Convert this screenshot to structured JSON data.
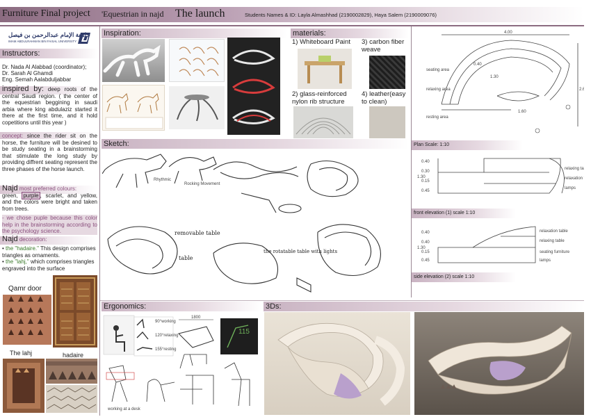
{
  "header": {
    "title": "Furniture Final project",
    "subtitle_prefix": "'Equestrian in najd",
    "subtitle_main": "The launch",
    "students": "Students Names & ID: Layla Almashhad (2190002829), Haya Salem (2190009076)"
  },
  "university": {
    "arabic": "جامعة الإمام عبدالرحمن بن فيصل",
    "english": "IMAM ABDULRAHMAN BIN FAISAL UNIVERSITY"
  },
  "left": {
    "instructors_title": "Instructors:",
    "instructors": [
      "Dr. Nada Al Alabbad (coordinator);",
      "Dr. Sarah Al Ghamdi",
      "Eng. Semah Aalabduljabbar"
    ],
    "inspired_label": "inspired by:",
    "inspired_text": " deep roots of the central Saudi region. ( the center of the equestrian beggining in saudi arbia where king abdulaziz started it there at the first time, and it hold copetitions until this year )",
    "concept_label": "concept:",
    "concept_text": " since the rider sit on the horse, the furniture will be desined to be study seating in a brainstorming that stimulate the long study by providing diffrent seating represent the three phases of the horse launch.",
    "najd_label": "Najd",
    "colours_label": " most preferred colours:",
    "colours_text_a": " green, ",
    "colours_purple": "purple",
    "colours_text_b": ", scarlet, and yellow, and the colors were bright and taken from trees.",
    "purple_note": "- we chose puple because this color help in the brainstorming according to the psychology science.",
    "decoration_label": "Najd",
    "decoration_suffix": " decoration:",
    "deco_item1_name": "the \"hadaire.\"",
    "deco_item1_text": " This design comprises triangles as ornaments.",
    "deco_item2_name": "the \"lahj,\"",
    "deco_item2_text": " which comprises triangles engraved into the surface",
    "qamr_door": "Qamr door",
    "the_lahj": "The lahj",
    "hadaire": "hadaire"
  },
  "sections": {
    "inspiration": "Inspiration:",
    "materials": "materials:",
    "sketch": "Sketch:",
    "ergonomics": "Ergonomics:",
    "threeds": "3Ds:",
    "plan_scale": "Plan Scale: 1:10",
    "front_elevation": "front elevation (1) scale 1:10",
    "side_elevation": "side elevation (2) scale 1:10"
  },
  "materials": {
    "m1": "1) Whiteboard Paint",
    "m2": "2) glass-reinforced nylon rib structure",
    "m3": "3) carbon fiber weave",
    "m4": "4) leather(easy to clean)"
  },
  "ergonomics": {
    "working_desk": "working at a desk",
    "dim_1800": "1800",
    "angle_115": "115",
    "positions": [
      "90°working",
      "120°relaxing",
      "155°resting"
    ]
  },
  "sketch_notes": {
    "note_rocking": "Rocking Movement",
    "note_removable": "removable table",
    "note_table": "table",
    "note_rotatable": "the rotatable table with lights"
  },
  "colors": {
    "accent": "#8b6b80",
    "band_light": "#e6d9e1",
    "purple_hl": "#8a4f7d",
    "fabric_purple": "#b9a0cc"
  }
}
